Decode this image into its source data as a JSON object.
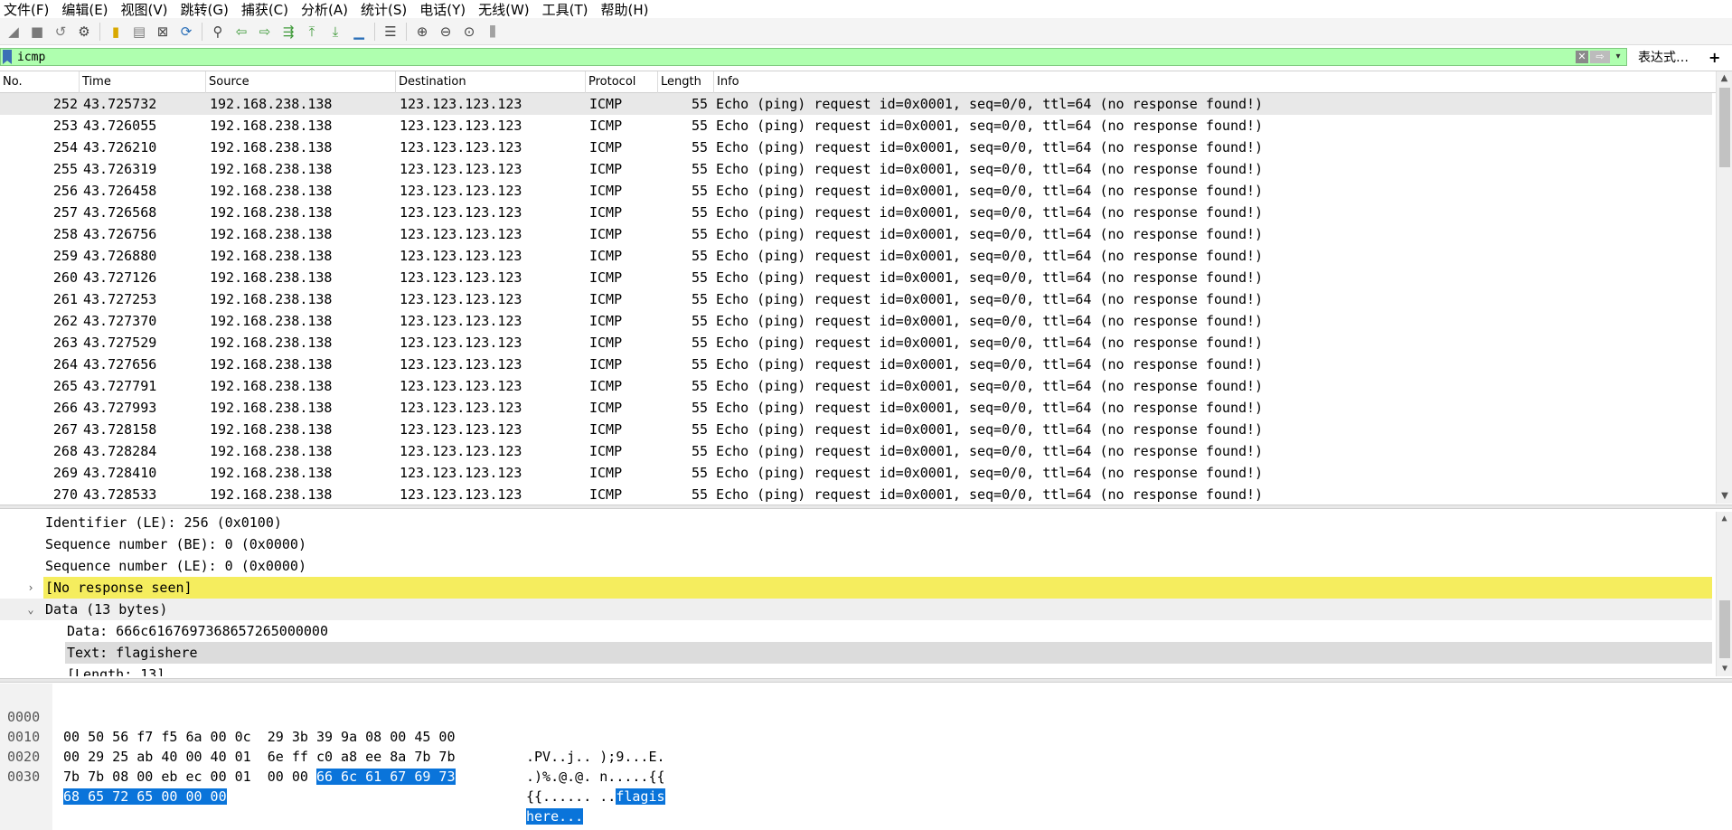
{
  "menu": [
    "文件(F)",
    "编辑(E)",
    "视图(V)",
    "跳转(G)",
    "捕获(C)",
    "分析(A)",
    "统计(S)",
    "电话(Y)",
    "无线(W)",
    "工具(T)",
    "帮助(H)"
  ],
  "filter": {
    "value": "icmp",
    "expression_label": "表达式…",
    "plus_label": "+"
  },
  "columns": [
    "No.",
    "Time",
    "Source",
    "Destination",
    "Protocol",
    "Length",
    "Info"
  ],
  "packets": [
    {
      "no": "252",
      "time": "43.725732",
      "src": "192.168.238.138",
      "dst": "123.123.123.123",
      "proto": "ICMP",
      "len": "55",
      "info": "Echo (ping) request  id=0x0001, seq=0/0, ttl=64 (no response found!)"
    },
    {
      "no": "253",
      "time": "43.726055",
      "src": "192.168.238.138",
      "dst": "123.123.123.123",
      "proto": "ICMP",
      "len": "55",
      "info": "Echo (ping) request  id=0x0001, seq=0/0, ttl=64 (no response found!)"
    },
    {
      "no": "254",
      "time": "43.726210",
      "src": "192.168.238.138",
      "dst": "123.123.123.123",
      "proto": "ICMP",
      "len": "55",
      "info": "Echo (ping) request  id=0x0001, seq=0/0, ttl=64 (no response found!)"
    },
    {
      "no": "255",
      "time": "43.726319",
      "src": "192.168.238.138",
      "dst": "123.123.123.123",
      "proto": "ICMP",
      "len": "55",
      "info": "Echo (ping) request  id=0x0001, seq=0/0, ttl=64 (no response found!)"
    },
    {
      "no": "256",
      "time": "43.726458",
      "src": "192.168.238.138",
      "dst": "123.123.123.123",
      "proto": "ICMP",
      "len": "55",
      "info": "Echo (ping) request  id=0x0001, seq=0/0, ttl=64 (no response found!)"
    },
    {
      "no": "257",
      "time": "43.726568",
      "src": "192.168.238.138",
      "dst": "123.123.123.123",
      "proto": "ICMP",
      "len": "55",
      "info": "Echo (ping) request  id=0x0001, seq=0/0, ttl=64 (no response found!)"
    },
    {
      "no": "258",
      "time": "43.726756",
      "src": "192.168.238.138",
      "dst": "123.123.123.123",
      "proto": "ICMP",
      "len": "55",
      "info": "Echo (ping) request  id=0x0001, seq=0/0, ttl=64 (no response found!)"
    },
    {
      "no": "259",
      "time": "43.726880",
      "src": "192.168.238.138",
      "dst": "123.123.123.123",
      "proto": "ICMP",
      "len": "55",
      "info": "Echo (ping) request  id=0x0001, seq=0/0, ttl=64 (no response found!)"
    },
    {
      "no": "260",
      "time": "43.727126",
      "src": "192.168.238.138",
      "dst": "123.123.123.123",
      "proto": "ICMP",
      "len": "55",
      "info": "Echo (ping) request  id=0x0001, seq=0/0, ttl=64 (no response found!)"
    },
    {
      "no": "261",
      "time": "43.727253",
      "src": "192.168.238.138",
      "dst": "123.123.123.123",
      "proto": "ICMP",
      "len": "55",
      "info": "Echo (ping) request  id=0x0001, seq=0/0, ttl=64 (no response found!)"
    },
    {
      "no": "262",
      "time": "43.727370",
      "src": "192.168.238.138",
      "dst": "123.123.123.123",
      "proto": "ICMP",
      "len": "55",
      "info": "Echo (ping) request  id=0x0001, seq=0/0, ttl=64 (no response found!)"
    },
    {
      "no": "263",
      "time": "43.727529",
      "src": "192.168.238.138",
      "dst": "123.123.123.123",
      "proto": "ICMP",
      "len": "55",
      "info": "Echo (ping) request  id=0x0001, seq=0/0, ttl=64 (no response found!)"
    },
    {
      "no": "264",
      "time": "43.727656",
      "src": "192.168.238.138",
      "dst": "123.123.123.123",
      "proto": "ICMP",
      "len": "55",
      "info": "Echo (ping) request  id=0x0001, seq=0/0, ttl=64 (no response found!)"
    },
    {
      "no": "265",
      "time": "43.727791",
      "src": "192.168.238.138",
      "dst": "123.123.123.123",
      "proto": "ICMP",
      "len": "55",
      "info": "Echo (ping) request  id=0x0001, seq=0/0, ttl=64 (no response found!)"
    },
    {
      "no": "266",
      "time": "43.727993",
      "src": "192.168.238.138",
      "dst": "123.123.123.123",
      "proto": "ICMP",
      "len": "55",
      "info": "Echo (ping) request  id=0x0001, seq=0/0, ttl=64 (no response found!)"
    },
    {
      "no": "267",
      "time": "43.728158",
      "src": "192.168.238.138",
      "dst": "123.123.123.123",
      "proto": "ICMP",
      "len": "55",
      "info": "Echo (ping) request  id=0x0001, seq=0/0, ttl=64 (no response found!)"
    },
    {
      "no": "268",
      "time": "43.728284",
      "src": "192.168.238.138",
      "dst": "123.123.123.123",
      "proto": "ICMP",
      "len": "55",
      "info": "Echo (ping) request  id=0x0001, seq=0/0, ttl=64 (no response found!)"
    },
    {
      "no": "269",
      "time": "43.728410",
      "src": "192.168.238.138",
      "dst": "123.123.123.123",
      "proto": "ICMP",
      "len": "55",
      "info": "Echo (ping) request  id=0x0001, seq=0/0, ttl=64 (no response found!)"
    },
    {
      "no": "270",
      "time": "43.728533",
      "src": "192.168.238.138",
      "dst": "123.123.123.123",
      "proto": "ICMP",
      "len": "55",
      "info": "Echo (ping) request  id=0x0001, seq=0/0, ttl=64 (no response found!)"
    }
  ],
  "details": {
    "identifier_le": "Identifier (LE): 256 (0x0100)",
    "seq_be": "Sequence number (BE): 0 (0x0000)",
    "seq_le": "Sequence number (LE): 0 (0x0000)",
    "no_response": "[No response seen]",
    "data_header": "Data (13 bytes)",
    "data_value": "Data: 666c6167697368657265000000",
    "text_value": "Text: flagishere",
    "length_value": "[Length: 13]"
  },
  "bytes": {
    "offsets": [
      "0000",
      "0010",
      "0020",
      "0030"
    ],
    "r0_hex": "00 50 56 f7 f5 6a 00 0c  29 3b 39 9a 08 00 45 00",
    "r0_ascii": ".PV..j.. );9...E.",
    "r1_hex": "00 29 25 ab 40 00 40 01  6e ff c0 a8 ee 8a 7b 7b",
    "r1_ascii": ".)%.@.@. n.....{{",
    "r2_hex_plain": "7b 7b 08 00 eb ec 00 01  00 00 ",
    "r2_hex_sel": "66 6c 61 67 69 73",
    "r2_ascii_plain": "{{...... ..",
    "r2_ascii_sel": "flagis",
    "r3_hex_sel": "68 65 72 65 00 00 00",
    "r3_ascii_sel": "here..."
  }
}
